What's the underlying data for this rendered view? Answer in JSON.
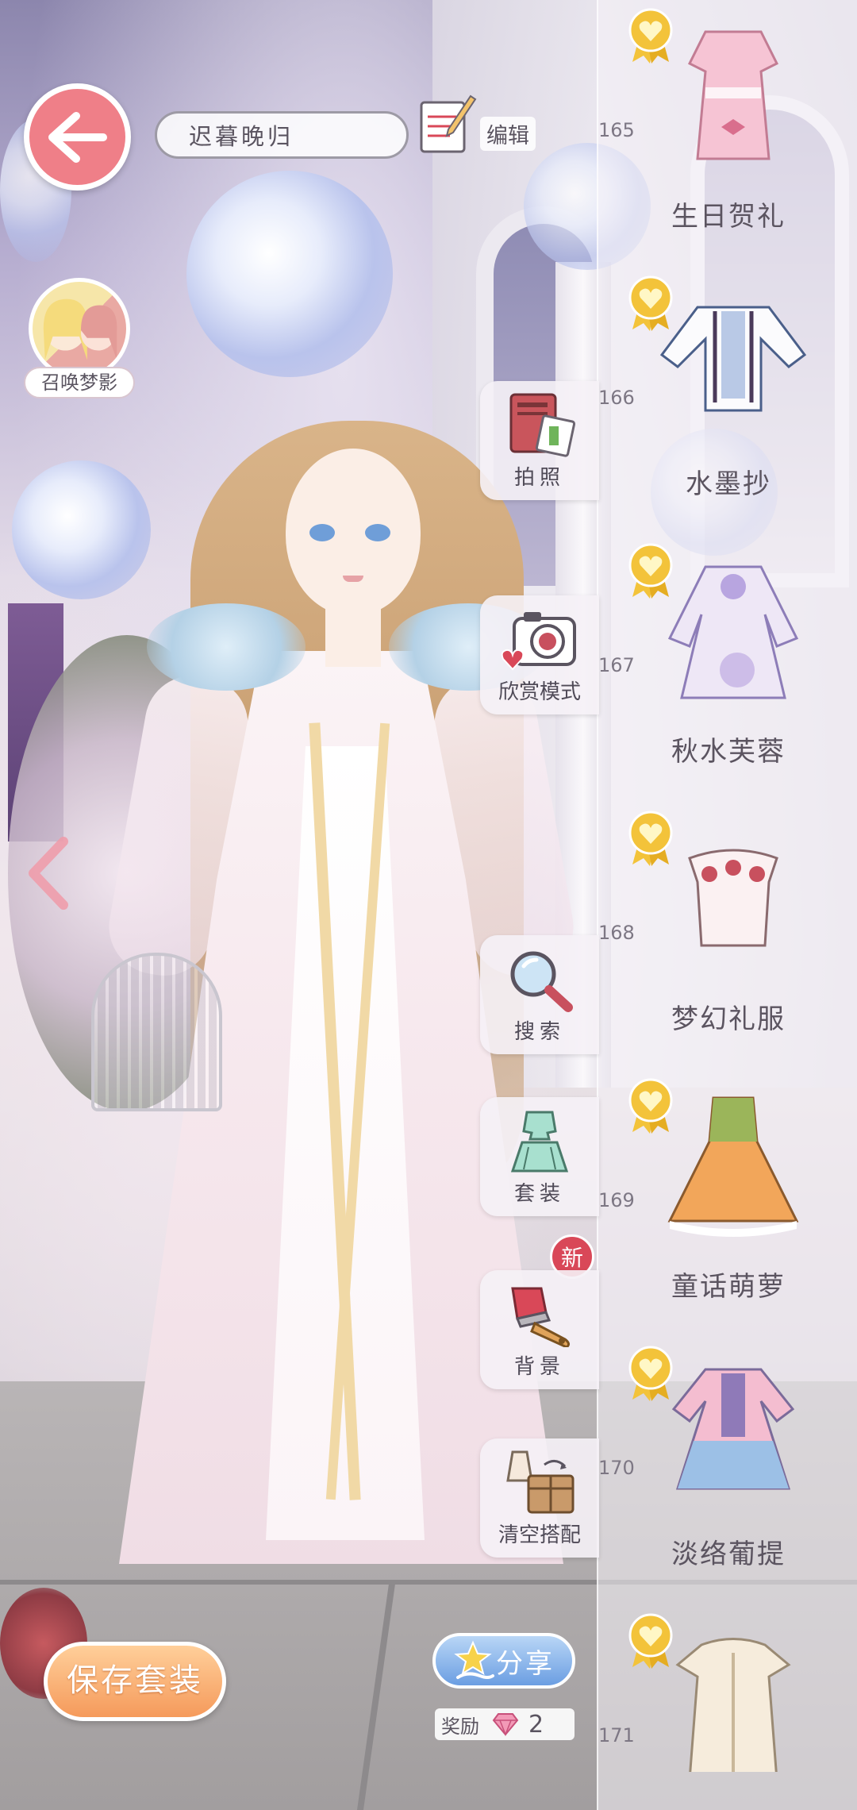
{
  "header": {
    "back_icon": "arrow-left-icon",
    "outfit_name_value": "迟暮晚归",
    "edit_label": "编辑",
    "edit_icon": "notepad-pencil-icon"
  },
  "summon": {
    "label": "召唤梦影",
    "icon": "twin-avatar-icon"
  },
  "tools": [
    {
      "label": "拍照",
      "icon": "photo-album-icon"
    },
    {
      "label": "欣赏模式",
      "icon": "camera-heart-icon"
    },
    {
      "label": "搜索",
      "icon": "magnifier-icon"
    },
    {
      "label": "套装",
      "icon": "dress-set-icon"
    },
    {
      "label": "背景",
      "icon": "paint-brush-icon",
      "badge": "新"
    },
    {
      "label": "清空搭配",
      "icon": "box-dress-icon"
    }
  ],
  "outfits": [
    {
      "number": "165",
      "name": "生日贺礼",
      "medal_icon": "gold-heart-medal-icon"
    },
    {
      "number": "166",
      "name": "水墨抄",
      "medal_icon": "gold-heart-medal-icon"
    },
    {
      "number": "167",
      "name": "秋水芙蓉",
      "medal_icon": "gold-heart-medal-icon"
    },
    {
      "number": "168",
      "name": "梦幻礼服",
      "medal_icon": "gold-heart-medal-icon"
    },
    {
      "number": "169",
      "name": "童话萌萝",
      "medal_icon": "gold-heart-medal-icon"
    },
    {
      "number": "170",
      "name": "淡络葡提",
      "medal_icon": "gold-heart-medal-icon"
    },
    {
      "number": "171",
      "name": "",
      "medal_icon": "gold-heart-medal-icon"
    }
  ],
  "footer": {
    "save_label": "保存套装",
    "share_label": "分享",
    "share_icon": "star-hand-icon",
    "reward_label": "奖励",
    "reward_icon": "pink-gem-icon",
    "reward_count": "2"
  },
  "colors": {
    "back_button": "#ef7f88",
    "save_button": "#f59a5b",
    "share_button": "#6b9ee2",
    "new_badge": "#d94858",
    "medal_gold": "#f3c33a"
  }
}
